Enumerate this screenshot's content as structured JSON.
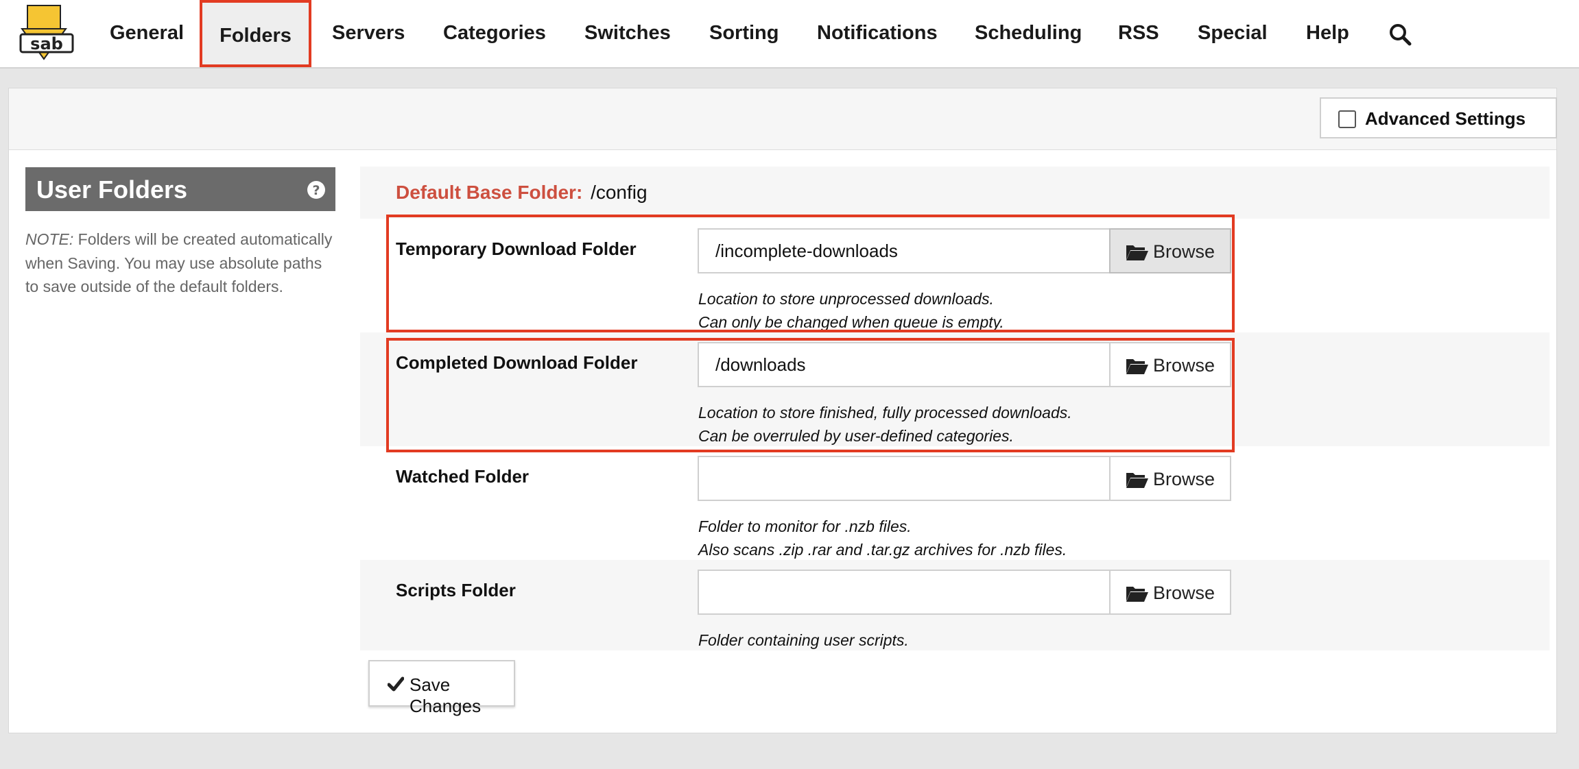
{
  "nav": {
    "logo_text": "sab",
    "items": [
      {
        "label": "General"
      },
      {
        "label": "Folders"
      },
      {
        "label": "Servers"
      },
      {
        "label": "Categories"
      },
      {
        "label": "Switches"
      },
      {
        "label": "Sorting"
      },
      {
        "label": "Notifications"
      },
      {
        "label": "Scheduling"
      },
      {
        "label": "RSS"
      },
      {
        "label": "Special"
      },
      {
        "label": "Help"
      }
    ],
    "active": "Folders"
  },
  "header": {
    "advanced_label": "Advanced Settings",
    "advanced_checked": false
  },
  "sidebar": {
    "title": "User Folders",
    "note_prefix": "NOTE:",
    "note_text": " Folders will be created automatically when Saving. You may use absolute paths to save outside of the default folders."
  },
  "form": {
    "base_label": "Default Base Folder:",
    "base_value": "/config",
    "browse_label": "Browse",
    "rows": [
      {
        "label": "Temporary Download Folder",
        "value": "/incomplete-downloads",
        "desc1": "Location to store unprocessed downloads.",
        "desc2": "Can only be changed when queue is empty."
      },
      {
        "label": "Completed Download Folder",
        "value": "/downloads",
        "desc1": "Location to store finished, fully processed downloads.",
        "desc2": "Can be overruled by user-defined categories."
      },
      {
        "label": "Watched Folder",
        "value": "",
        "desc1": "Folder to monitor for .nzb files.",
        "desc2": "Also scans .zip .rar and .tar.gz archives for .nzb files."
      },
      {
        "label": "Scripts Folder",
        "value": "",
        "desc1": "Folder containing user scripts."
      }
    ],
    "save_label": "Save Changes"
  },
  "colors": {
    "highlight": "#e23b22",
    "accent_label": "#cd4f3f",
    "logo_yellow": "#f5c533"
  }
}
